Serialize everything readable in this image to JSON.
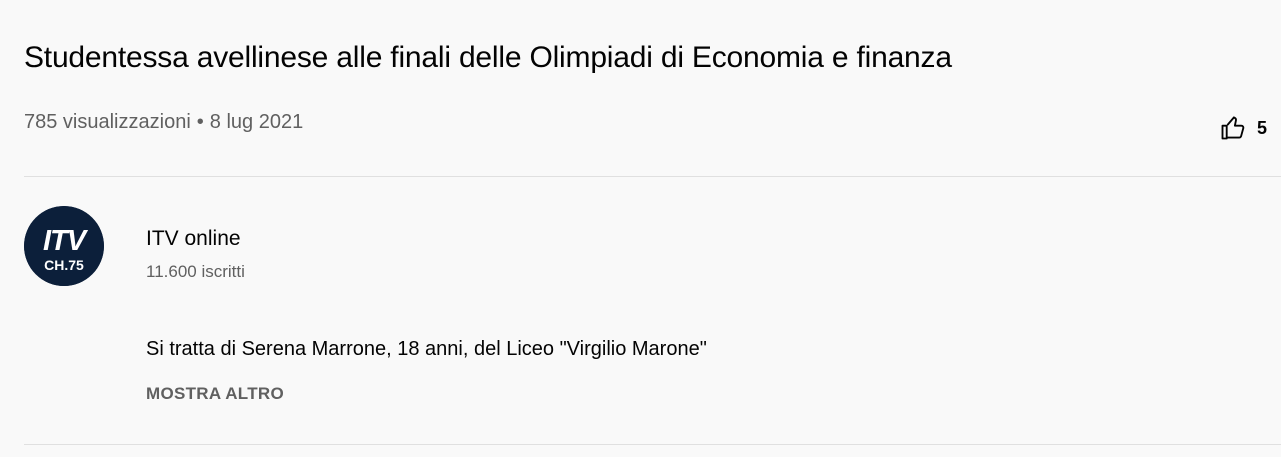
{
  "video": {
    "title": "Studentessa avellinese alle finali delle Olimpiadi di Economia e finanza",
    "views": "785 visualizzazioni",
    "separator": "•",
    "date": "8 lug 2021",
    "likes": "5"
  },
  "channel": {
    "name": "ITV online",
    "subscribers": "11.600 iscritti",
    "logo": {
      "top_text": "ITV",
      "bottom_text": "CH.75",
      "background_color": "#0c1f3a",
      "accent_color": "#ffffff"
    }
  },
  "description": {
    "text": "Si tratta di Serena Marrone, 18 anni, del Liceo \"Virgilio Marone\"",
    "show_more_label": "MOSTRA ALTRO"
  },
  "icons": {
    "like": "thumbs-up-icon"
  },
  "colors": {
    "background": "#f9f9f9",
    "primary_text": "#030303",
    "secondary_text": "#606060",
    "divider": "#e0e0e0"
  }
}
